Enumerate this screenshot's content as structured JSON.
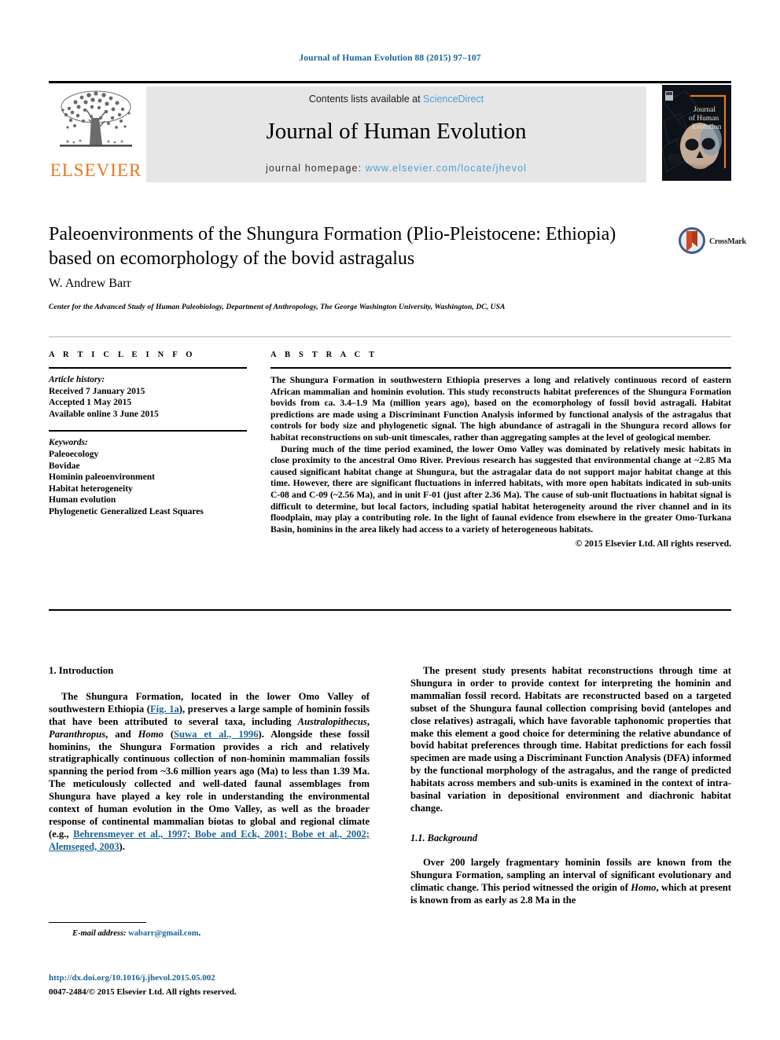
{
  "running_head": "Journal of Human Evolution 88 (2015) 97–107",
  "masthead": {
    "contents_prefix": "Contents lists available at ",
    "contents_link": "ScienceDirect",
    "journal_title": "Journal of Human Evolution",
    "homepage_prefix": "journal homepage: ",
    "homepage_link": "www.elsevier.com/locate/jhevol",
    "publisher": "ELSEVIER",
    "cover_title_lines": [
      "Journal",
      "of Human",
      "Evolution"
    ],
    "logo_color": "#e87722",
    "link_color": "#4b9fd5",
    "band_color": "#e6e6e6"
  },
  "article": {
    "title": "Paleoenvironments of the Shungura Formation (Plio-Pleistocene: Ethiopia) based on ecomorphology of the bovid astragalus",
    "author": "W. Andrew Barr",
    "affiliation": "Center for the Advanced Study of Human Paleobiology, Department of Anthropology, The George Washington University, Washington, DC, USA",
    "crossmark_label": "CrossMark"
  },
  "info": {
    "heading": "A R T I C L E   I N F O",
    "history_label": "Article history:",
    "history": [
      "Received 7 January 2015",
      "Accepted 1 May 2015",
      "Available online 3 June 2015"
    ],
    "keywords_label": "Keywords:",
    "keywords": [
      "Paleoecology",
      "Bovidae",
      "Hominin paleoenvironment",
      "Habitat heterogeneity",
      "Human evolution",
      "Phylogenetic Generalized Least Squares"
    ]
  },
  "abstract": {
    "heading": "A B S T R A C T",
    "paragraph_1": "The Shungura Formation in southwestern Ethiopia preserves a long and relatively continuous record of eastern African mammalian and hominin evolution. This study reconstructs habitat preferences of the Shungura Formation bovids from ca. 3.4–1.9 Ma (million years ago), based on the ecomorphology of fossil bovid astragali. Habitat predictions are made using a Discriminant Function Analysis informed by functional analysis of the astragalus that controls for body size and phylogenetic signal. The high abundance of astragali in the Shungura record allows for habitat reconstructions on sub-unit timescales, rather than aggregating samples at the level of geological member.",
    "paragraph_2": "During much of the time period examined, the lower Omo Valley was dominated by relatively mesic habitats in close proximity to the ancestral Omo River. Previous research has suggested that environmental change at ~2.85 Ma caused significant habitat change at Shungura, but the astragalar data do not support major habitat change at this time. However, there are significant fluctuations in inferred habitats, with more open habitats indicated in sub-units C-08 and C-09 (~2.56 Ma), and in unit F-01 (just after 2.36 Ma). The cause of sub-unit fluctuations in habitat signal is difficult to determine, but local factors, including spatial habitat heterogeneity around the river channel and in its floodplain, may play a contributing role. In the light of faunal evidence from elsewhere in the greater Omo-Turkana Basin, hominins in the area likely had access to a variety of heterogeneous habitats.",
    "copyright": "© 2015 Elsevier Ltd. All rights reserved."
  },
  "body": {
    "intro_heading": "1. Introduction",
    "intro_p1_a": "The Shungura Formation, located in the lower Omo Valley of southwestern Ethiopia (",
    "intro_fig_link": "Fig. 1a",
    "intro_p1_b": "), preserves a large sample of hominin fossils that have been attributed to several taxa, including ",
    "intro_taxa_1": "Australopithecus",
    "intro_taxa_sep1": ", ",
    "intro_taxa_2": "Paranthropus",
    "intro_taxa_sep2": ", and ",
    "intro_taxa_3": "Homo",
    "intro_p1_c": " (",
    "intro_cite_1": "Suwa et al., 1996",
    "intro_p1_d": "). Alongside these fossil hominins, the Shungura Formation provides a rich and relatively stratigraphically continuous collection of non-hominin mammalian fossils spanning the period from ~3.6 million years ago (Ma) to less than 1.39 Ma. The meticulously collected and well-dated faunal assemblages from Shungura have played a key role in understanding the environmental context of human evolution in the Omo Valley, as well as the broader response of continental mammalian biotas to global and regional climate (e.g., ",
    "intro_cite_2": "Behrensmeyer et al., 1997; Bobe and Eck, 2001; Bobe et al., 2002; Alemseged, 2003",
    "intro_p1_e": ").",
    "right_p1": "The present study presents habitat reconstructions through time at Shungura in order to provide context for interpreting the hominin and mammalian fossil record. Habitats are reconstructed based on a targeted subset of the Shungura faunal collection comprising bovid (antelopes and close relatives) astragali, which have favorable taphonomic properties that make this element a good choice for determining the relative abundance of bovid habitat preferences through time. Habitat predictions for each fossil specimen are made using a Discriminant Function Analysis (DFA) informed by the functional morphology of the astragalus, and the range of predicted habitats across members and sub-units is examined in the context of intra-basinal variation in depositional environment and diachronic habitat change.",
    "background_heading": "1.1. Background",
    "background_p1_a": "Over 200 largely fragmentary hominin fossils are known from the Shungura Formation, sampling an interval of significant evolutionary and climatic change. This period witnessed the origin of ",
    "background_homo": "Homo",
    "background_p1_b": ", which at present is known from as early as 2.8 Ma in the"
  },
  "footer": {
    "email_label": "E-mail address:",
    "email": "wabarr@gmail.com",
    "email_suffix": ".",
    "doi": "http://dx.doi.org/10.1016/j.jhevol.2015.05.002",
    "issn_copyright": "0047-2484/© 2015 Elsevier Ltd. All rights reserved."
  },
  "colors": {
    "link_blue": "#1a6496",
    "sciencedirect_blue": "#4b9fd5",
    "elsevier_orange": "#e87722"
  }
}
